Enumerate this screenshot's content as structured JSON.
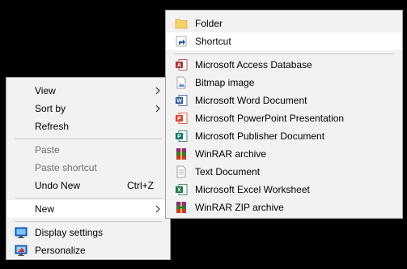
{
  "context_menu": {
    "items": {
      "view": {
        "label": "View"
      },
      "sort_by": {
        "label": "Sort by"
      },
      "refresh": {
        "label": "Refresh"
      },
      "paste": {
        "label": "Paste"
      },
      "paste_shortcut": {
        "label": "Paste shortcut"
      },
      "undo_new": {
        "label": "Undo New",
        "shortcut": "Ctrl+Z"
      },
      "new": {
        "label": "New"
      },
      "display_settings": {
        "label": "Display settings"
      },
      "personalize": {
        "label": "Personalize"
      }
    }
  },
  "new_submenu": {
    "items": {
      "folder": {
        "label": "Folder",
        "icon": "folder-icon"
      },
      "shortcut": {
        "label": "Shortcut",
        "icon": "shortcut-icon"
      },
      "access": {
        "label": "Microsoft Access Database",
        "icon": "access-icon"
      },
      "bitmap": {
        "label": "Bitmap image",
        "icon": "bitmap-icon"
      },
      "word": {
        "label": "Microsoft Word Document",
        "icon": "word-icon"
      },
      "powerpoint": {
        "label": "Microsoft PowerPoint Presentation",
        "icon": "powerpoint-icon"
      },
      "publisher": {
        "label": "Microsoft Publisher Document",
        "icon": "publisher-icon"
      },
      "winrar": {
        "label": "WinRAR archive",
        "icon": "winrar-icon"
      },
      "text": {
        "label": "Text Document",
        "icon": "text-document-icon"
      },
      "excel": {
        "label": "Microsoft Excel Worksheet",
        "icon": "excel-icon"
      },
      "winrar_zip": {
        "label": "WinRAR ZIP archive",
        "icon": "winrar-zip-icon"
      }
    }
  },
  "colors": {
    "desktop": "#000000",
    "menu_bg": "#f2f2f2",
    "highlight": "#ffffff",
    "disabled_text": "#6d6d6d",
    "word_blue": "#2b579a",
    "excel_green": "#217346",
    "powerpoint_red": "#d24726",
    "access_red": "#a4373a",
    "publisher_teal": "#077568"
  }
}
